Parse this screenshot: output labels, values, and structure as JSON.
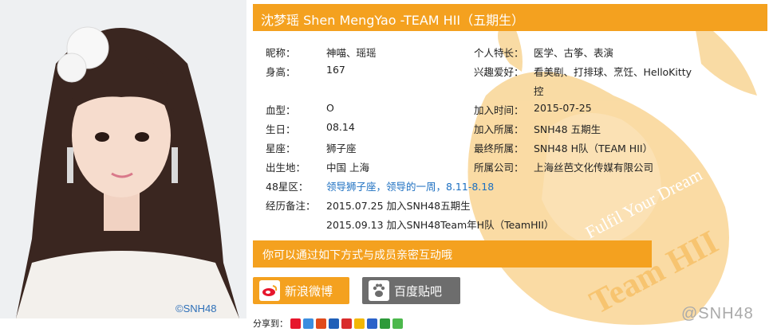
{
  "photo": {
    "watermark": "©SNH48"
  },
  "header": {
    "title": "沈梦瑶  Shen MengYao -TEAM HII（五期生）"
  },
  "left": [
    {
      "label": "昵称：",
      "value": "神喵、瑶瑶"
    },
    {
      "label": "身高：",
      "value": "167"
    },
    {
      "label": "血型：",
      "value": "O"
    },
    {
      "label": "生日：",
      "value": "08.14"
    },
    {
      "label": "星座：",
      "value": "狮子座"
    },
    {
      "label": "出生地：",
      "value": "中国 上海"
    },
    {
      "label": "48星区：",
      "value": "领导狮子座，领导的一周，8.11-8.18"
    },
    {
      "label": "经历备注：",
      "value": "2015.07.25 加入SNH48五期生"
    }
  ],
  "history_extra": "2015.09.13 加入SNH48Team年H队（TeamHII）",
  "right": [
    {
      "label": "个人特长：",
      "value": "医学、古筝、表演"
    },
    {
      "label": "兴趣爱好：",
      "value": "看美剧、打排球、烹饪、HelloKitty",
      "value2": "控"
    },
    {
      "label": "加入时间：",
      "value": "2015-07-25"
    },
    {
      "label": "加入所属：",
      "value": "SNH48 五期生"
    },
    {
      "label": "最终所属：",
      "value": "SNH48 H队（TEAM HII）"
    },
    {
      "label": "所属公司：",
      "value": "上海丝芭文化传媒有限公司"
    }
  ],
  "contact": {
    "text": "你可以通过如下方式与成员亲密互动哦"
  },
  "buttons": {
    "weibo": "新浪微博",
    "tieba": "百度贴吧"
  },
  "share": {
    "label": "分享到："
  },
  "corner_watermark": "@SNH48",
  "deco_text": {
    "line1": "Fulfil Your Dream",
    "line2": "Team HII"
  },
  "colors": {
    "accent": "#f4a11f",
    "link": "#1c6fc1",
    "grey_button": "#6d6d6d"
  }
}
